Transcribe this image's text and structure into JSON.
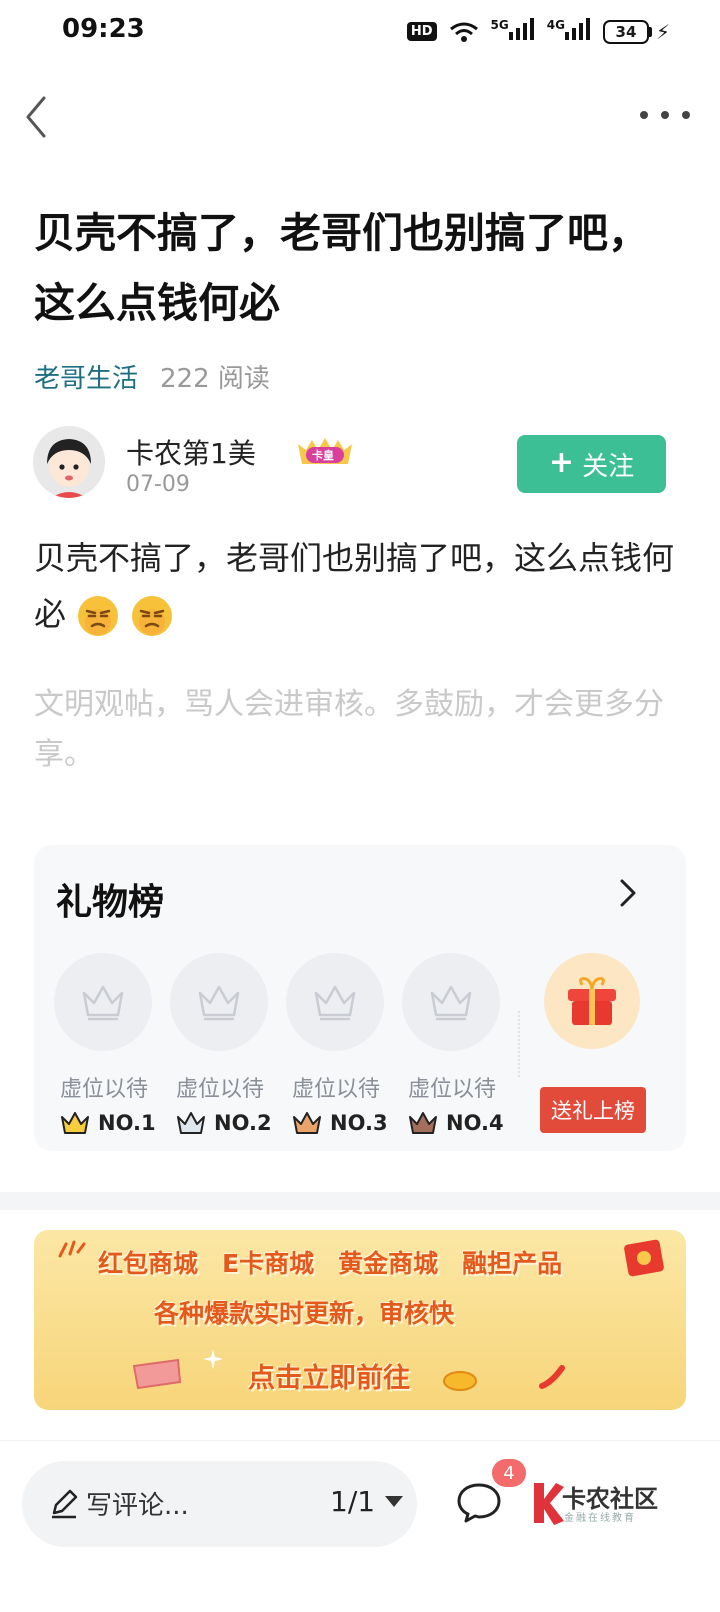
{
  "status_bar": {
    "time": "09:23",
    "hd": "HD",
    "signal_5g": "5G",
    "signal_4g": "4G",
    "battery": "34"
  },
  "nav": {
    "back_icon": "chevron-left-icon",
    "more_icon": "more-dots-icon"
  },
  "post": {
    "title": "贝壳不搞了，老哥们也别搞了吧，这么点钱何必",
    "category": "老哥生活",
    "read_count": "222 阅读",
    "author": {
      "name": "卡农第1美",
      "badge": "卡皇",
      "date": "07-09"
    },
    "follow_label": "关注",
    "body": "贝壳不搞了，老哥们也别搞了吧，这么点钱何必",
    "notice": "文明观帖，骂人会进审核。多鼓励，才会更多分享。"
  },
  "gift_board": {
    "title": "礼物榜",
    "slots": [
      {
        "label": "虚位以待",
        "rank": "NO.1"
      },
      {
        "label": "虚位以待",
        "rank": "NO.2"
      },
      {
        "label": "虚位以待",
        "rank": "NO.3"
      },
      {
        "label": "虚位以待",
        "rank": "NO.4"
      }
    ],
    "send_gift_label": "送礼上榜"
  },
  "banner": {
    "items": [
      "红包商城",
      "E卡商城",
      "黄金商城",
      "融担产品"
    ],
    "line2": "各种爆款实时更新，审核快",
    "cta": "点击立即前往"
  },
  "bottom_bar": {
    "comment_placeholder": "写评论...",
    "page": "1/1",
    "comment_count": "4",
    "brand_name": "卡农社区",
    "brand_sub": "金融在线教育"
  },
  "colors": {
    "accent": "#3dbf96",
    "category": "#1e6f82",
    "gift_button": "#e24a3a",
    "badge_red": "#f36b6b"
  }
}
